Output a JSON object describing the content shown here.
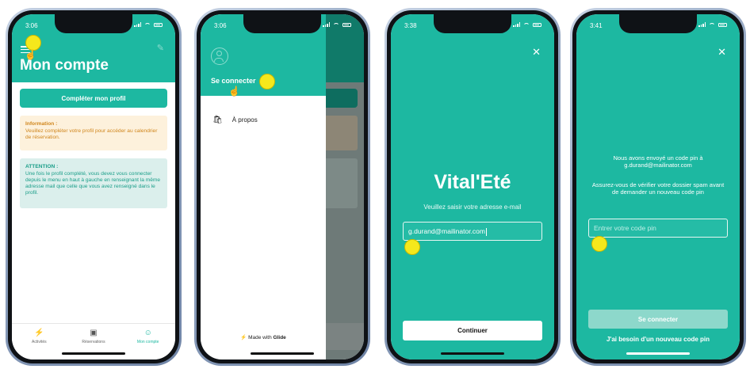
{
  "colors": {
    "accent": "#1db8a1",
    "highlight_dot": "#f5e81c",
    "info_text": "#d0861d",
    "info_bg": "#fdf1dc",
    "warn_text": "#1a9e89",
    "warn_bg": "#dbefec"
  },
  "phone1": {
    "time": "3:06",
    "title": "Mon compte",
    "complete_profile_button": "Compléter mon profil",
    "info_title": "Information :",
    "info_text": "Veuillez compléter votre profil pour accéder au calendrier de réservation.",
    "warning_title": "ATTENTION :",
    "warning_text": "Une fois le profil complété, vous devez vous connecter depuis le menu en haut à gauche en renseignant la même adresse mail que celle que vous avez renseigné dans le profil.",
    "tabs": [
      {
        "label": "Activités",
        "icon": "running-person-icon"
      },
      {
        "label": "Réservations",
        "icon": "play-square-icon"
      },
      {
        "label": "Mon compte",
        "icon": "user-check-icon"
      }
    ]
  },
  "phone2": {
    "time": "3:06",
    "connect_label": "Se connecter",
    "about_label": "À propos",
    "made_with_prefix": "Made with",
    "made_with_brand": "Glide"
  },
  "phone3": {
    "time": "3:38",
    "brand": "Vital'Eté",
    "prompt": "Veuillez saisir votre adresse e-mail",
    "email_value": "g.durand@mailinator.com",
    "continue_button": "Continuer"
  },
  "phone4": {
    "time": "3:41",
    "sent_message": "Nous avons envoyé un code pin à g.durand@mailinator.com",
    "spam_message": "Assurez-vous de vérifier votre dossier spam avant de demander un nouveau code pin",
    "pin_placeholder": "Entrer votre code pin",
    "connect_button": "Se connecter",
    "new_pin_link": "J'ai besoin d'un nouveau code pin"
  }
}
